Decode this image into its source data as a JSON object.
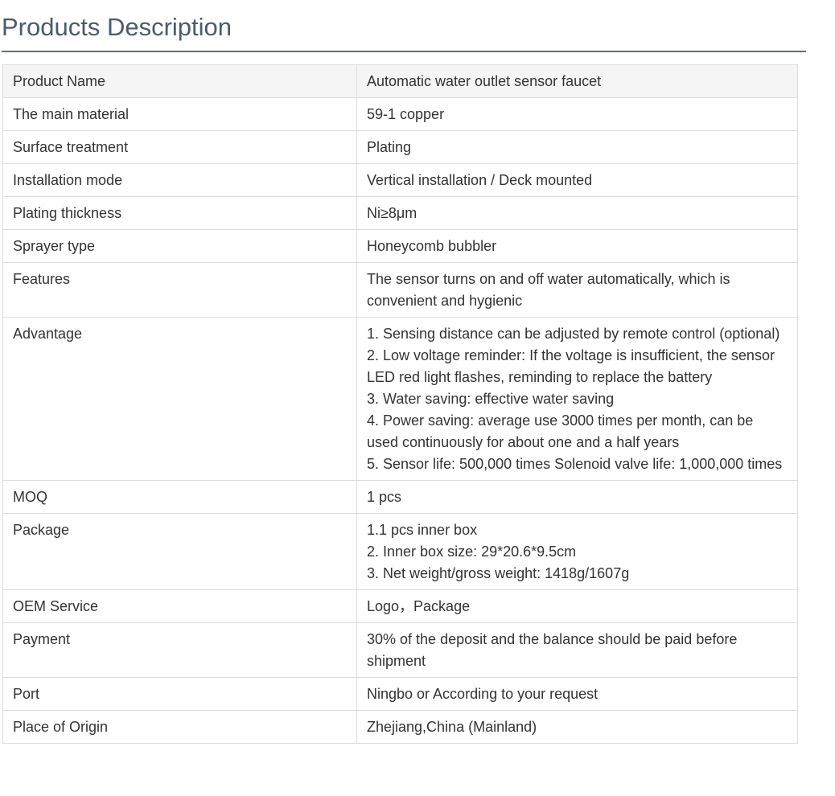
{
  "section": {
    "title": "Products Description"
  },
  "rows": [
    {
      "label": "Product Name",
      "value": "Automatic water outlet sensor faucet"
    },
    {
      "label": "The main material",
      "value": "59-1 copper"
    },
    {
      "label": "Surface treatment",
      "value": "Plating"
    },
    {
      "label": "Installation mode",
      "value": "Vertical installation / Deck mounted"
    },
    {
      "label": "Plating thickness",
      "value": "Ni≥8μm"
    },
    {
      "label": "Sprayer type",
      "value": "Honeycomb bubbler"
    },
    {
      "label": "Features",
      "value": "The sensor turns on and off water automatically, which is convenient and hygienic"
    },
    {
      "label": "Advantage",
      "value": "1. Sensing distance can be adjusted by remote control (optional)\n2. Low voltage reminder: If the voltage is insufficient, the sensor LED red light flashes, reminding to replace the battery\n3. Water saving: effective water saving\n4. Power saving: average use 3000 times per month, can be used continuously for about one and a half years\n5. Sensor life: 500,000 times Solenoid valve life: 1,000,000 times"
    },
    {
      "label": "MOQ",
      "value": "1 pcs"
    },
    {
      "label": "Package",
      "value": "1.1 pcs inner box\n2. Inner box size: 29*20.6*9.5cm\n3. Net weight/gross weight: 1418g/1607g"
    },
    {
      "label": "OEM Service",
      "value": "Logo，Package"
    },
    {
      "label": "Payment",
      "value": "30% of the deposit and the balance should be paid before shipment"
    },
    {
      "label": "Port",
      "value": "Ningbo or According to your request"
    },
    {
      "label": "Place of Origin",
      "value": "Zhejiang,China (Mainland)"
    }
  ],
  "colors": {
    "title": "#4b5a6e",
    "title_rule": "#5c6e85",
    "border": "#dddddd",
    "header_row_bg": "#f5f5f5",
    "text": "#333333"
  }
}
